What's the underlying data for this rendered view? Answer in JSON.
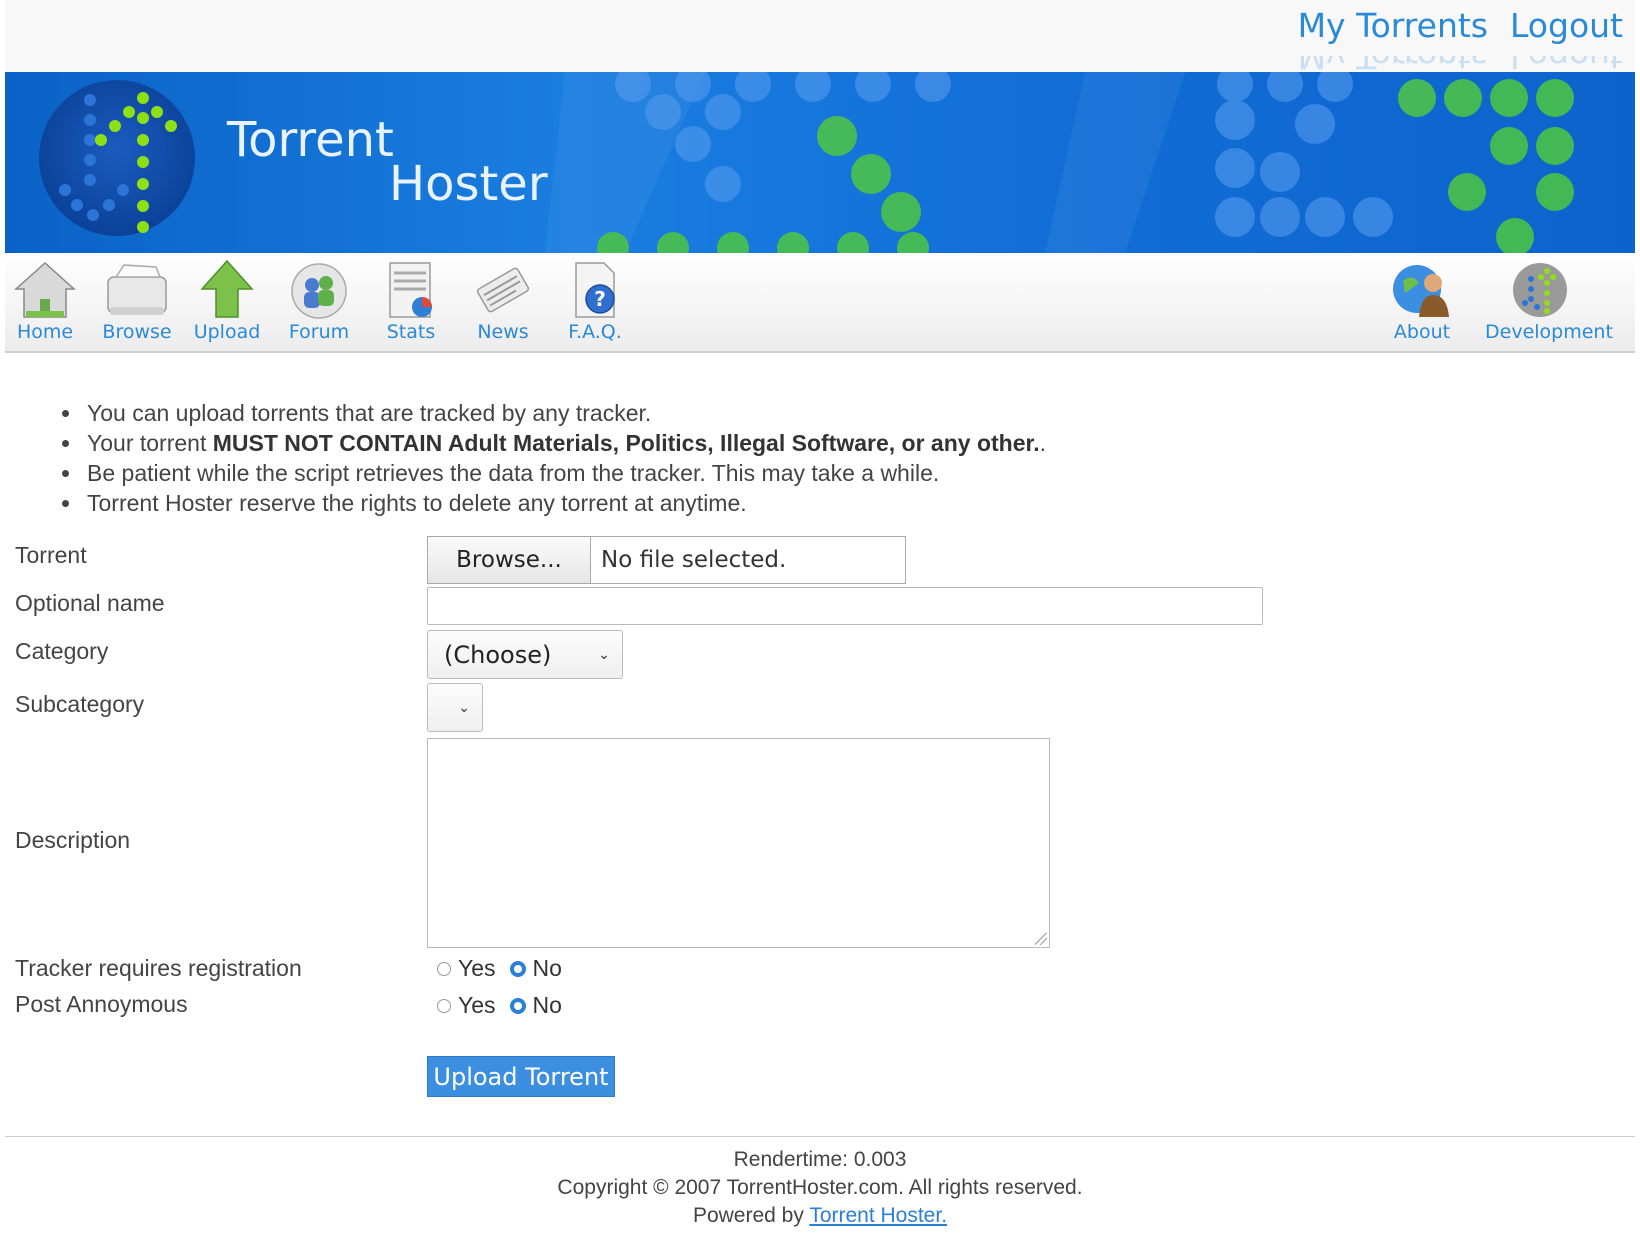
{
  "header": {
    "links": [
      "My Torrents",
      "Logout"
    ]
  },
  "banner": {
    "brand_line1": "Torrent",
    "brand_line2": "Hoster"
  },
  "nav": {
    "items": [
      {
        "label": "Home",
        "icon": "home-icon"
      },
      {
        "label": "Browse",
        "icon": "browse-icon"
      },
      {
        "label": "Upload",
        "icon": "upload-arrow-icon"
      },
      {
        "label": "Forum",
        "icon": "forum-icon"
      },
      {
        "label": "Stats",
        "icon": "stats-icon"
      },
      {
        "label": "News",
        "icon": "news-icon"
      },
      {
        "label": "F.A.Q.",
        "icon": "faq-icon"
      },
      {
        "label": "About",
        "icon": "about-icon"
      },
      {
        "label": "Development",
        "icon": "development-icon"
      }
    ]
  },
  "rules": {
    "item1": "You can upload torrents that are tracked by any tracker.",
    "item2_pre": "Your torrent ",
    "item2_bold": "MUST NOT CONTAIN Adult Materials, Politics, Illegal Software, or any other.",
    "item2_post": ".",
    "item3": "Be patient while the script retrieves the data from the tracker. This may take a while.",
    "item4": "Torrent Hoster reserve the rights to delete any torrent at anytime."
  },
  "form": {
    "torrent_label": "Torrent",
    "browse_button": "Browse...",
    "file_status": "No file selected.",
    "optional_name_label": "Optional name",
    "optional_name_value": "",
    "category_label": "Category",
    "category_value": "(Choose)",
    "subcategory_label": "Subcategory",
    "subcategory_value": "",
    "description_label": "Description",
    "description_value": "",
    "tracker_label": "Tracker requires registration",
    "anon_label": "Post Annoymous",
    "yes": "Yes",
    "no": "No",
    "tracker_selected": "No",
    "anon_selected": "No",
    "submit": "Upload Torrent"
  },
  "footer": {
    "rendertime": "Rendertime: 0.003",
    "copyright": "Copyright © 2007 TorrentHoster.com. All rights reserved.",
    "powered_pre": "Powered by ",
    "powered_link": "Torrent Hoster."
  },
  "colors": {
    "link": "#2a8ad8",
    "banner": "#0a62c6",
    "accent_green": "#7ed321",
    "submit": "#3c8ee0"
  }
}
